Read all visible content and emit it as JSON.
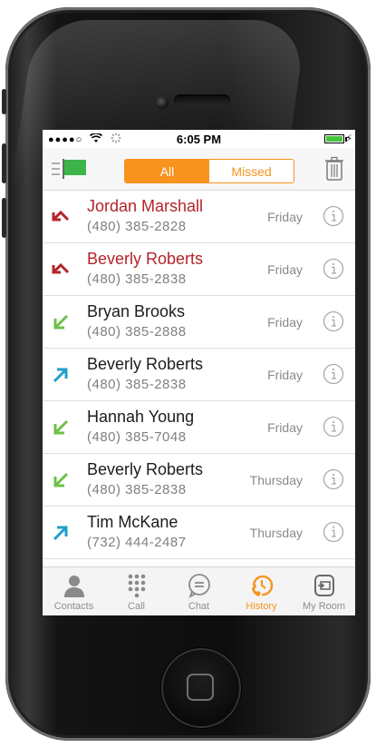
{
  "status_bar": {
    "signal": "●●●●○",
    "time": "6:05 PM",
    "charge_symbol": "⚡"
  },
  "top_bar": {
    "segments": [
      {
        "label": "All",
        "active": true
      },
      {
        "label": "Missed",
        "active": false
      }
    ]
  },
  "colors": {
    "accent": "#f7931e",
    "missed": "#b3242a",
    "incoming": "#6cc04a",
    "outgoing": "#1fa1c8"
  },
  "calls": [
    {
      "name": "Jordan Marshall",
      "number": "(480) 385-2828",
      "day": "Friday",
      "type": "missed"
    },
    {
      "name": "Beverly Roberts",
      "number": "(480) 385-2838",
      "day": "Friday",
      "type": "missed"
    },
    {
      "name": "Bryan Brooks",
      "number": "(480) 385-2888",
      "day": "Friday",
      "type": "incoming"
    },
    {
      "name": "Beverly Roberts",
      "number": "(480) 385-2838",
      "day": "Friday",
      "type": "outgoing"
    },
    {
      "name": "Hannah Young",
      "number": "(480) 385-7048",
      "day": "Friday",
      "type": "incoming"
    },
    {
      "name": "Beverly Roberts",
      "number": "(480) 385-2838",
      "day": "Thursday",
      "type": "incoming"
    },
    {
      "name": "Tim McKane",
      "number": "(732) 444-2487",
      "day": "Thursday",
      "type": "outgoing"
    }
  ],
  "tabs": [
    {
      "label": "Contacts",
      "icon": "contacts-icon",
      "active": false
    },
    {
      "label": "Call",
      "icon": "dialpad-icon",
      "active": false
    },
    {
      "label": "Chat",
      "icon": "chat-icon",
      "active": false
    },
    {
      "label": "History",
      "icon": "history-icon",
      "active": true
    },
    {
      "label": "My Room",
      "icon": "my-room-icon",
      "active": false
    }
  ]
}
